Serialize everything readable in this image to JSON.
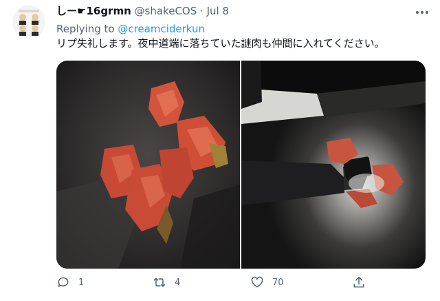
{
  "tweet": {
    "display_name": "しー☛16grmn",
    "handle": "@shakeCOS",
    "separator": "·",
    "date": "Jul 8",
    "replying_prefix": "Replying to ",
    "replying_to": "@creamciderkun",
    "text": "リプ失礼します。夜中道端に落ちていた謎肉も仲間に入れてください。"
  },
  "actions": {
    "reply_count": "1",
    "retweet_count": "4",
    "like_count": "70"
  },
  "icons": {
    "more": "more-icon",
    "reply": "reply-icon",
    "retweet": "retweet-icon",
    "like": "heart-icon",
    "share": "share-icon"
  },
  "colors": {
    "accent": "#1d9bf0",
    "secondary_text": "#536471",
    "primary_text": "#0f1419"
  }
}
